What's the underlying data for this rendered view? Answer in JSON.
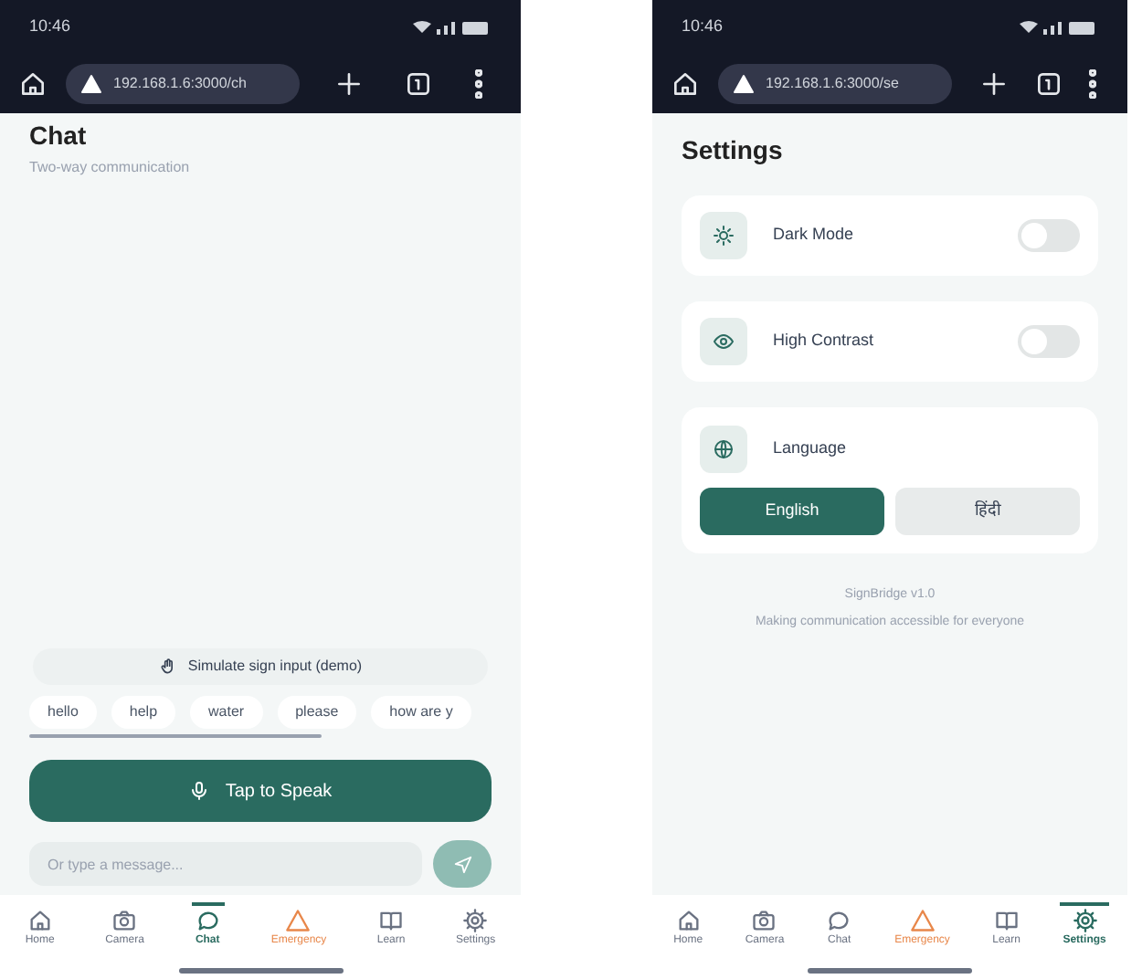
{
  "phones": [
    {
      "kind": "chat",
      "status_bar": {
        "time": "10:46"
      },
      "browser": {
        "url": "192.168.1.6:3000/ch"
      },
      "chat": {
        "title": "Chat",
        "subtitle": "Two-way communication",
        "simulate_button": "Simulate sign input (demo)",
        "chips": [
          "hello",
          "help",
          "water",
          "please",
          "how are y"
        ],
        "speak_button": "Tap to Speak",
        "message_field": {
          "placeholder": "Or type a message..."
        }
      },
      "nav": [
        {
          "label": "Home",
          "selected": false,
          "alert": false
        },
        {
          "label": "Camera",
          "selected": false,
          "alert": false
        },
        {
          "label": "Chat",
          "selected": true,
          "alert": false
        },
        {
          "label": "Emergency",
          "selected": false,
          "alert": true
        },
        {
          "label": "Learn",
          "selected": false,
          "alert": false
        },
        {
          "label": "Settings",
          "selected": false,
          "alert": false
        }
      ]
    },
    {
      "kind": "settings",
      "status_bar": {
        "time": "10:46"
      },
      "browser": {
        "url": "192.168.1.6:3000/se"
      },
      "settings": {
        "title": "Settings",
        "toggles": [
          {
            "label": "Dark Mode",
            "on": false
          },
          {
            "label": "High Contrast",
            "on": false
          }
        ],
        "language": {
          "label": "Language",
          "options": [
            {
              "label": "English",
              "selected": true
            },
            {
              "label": "हिंदी",
              "selected": false
            }
          ]
        },
        "footer": {
          "version": "SignBridge v1.0",
          "tagline": "Making communication accessible for everyone"
        }
      },
      "nav": [
        {
          "label": "Home",
          "selected": false,
          "alert": false
        },
        {
          "label": "Camera",
          "selected": false,
          "alert": false
        },
        {
          "label": "Chat",
          "selected": false,
          "alert": false
        },
        {
          "label": "Emergency",
          "selected": false,
          "alert": true
        },
        {
          "label": "Learn",
          "selected": false,
          "alert": false
        },
        {
          "label": "Settings",
          "selected": true,
          "alert": false
        }
      ]
    }
  ]
}
